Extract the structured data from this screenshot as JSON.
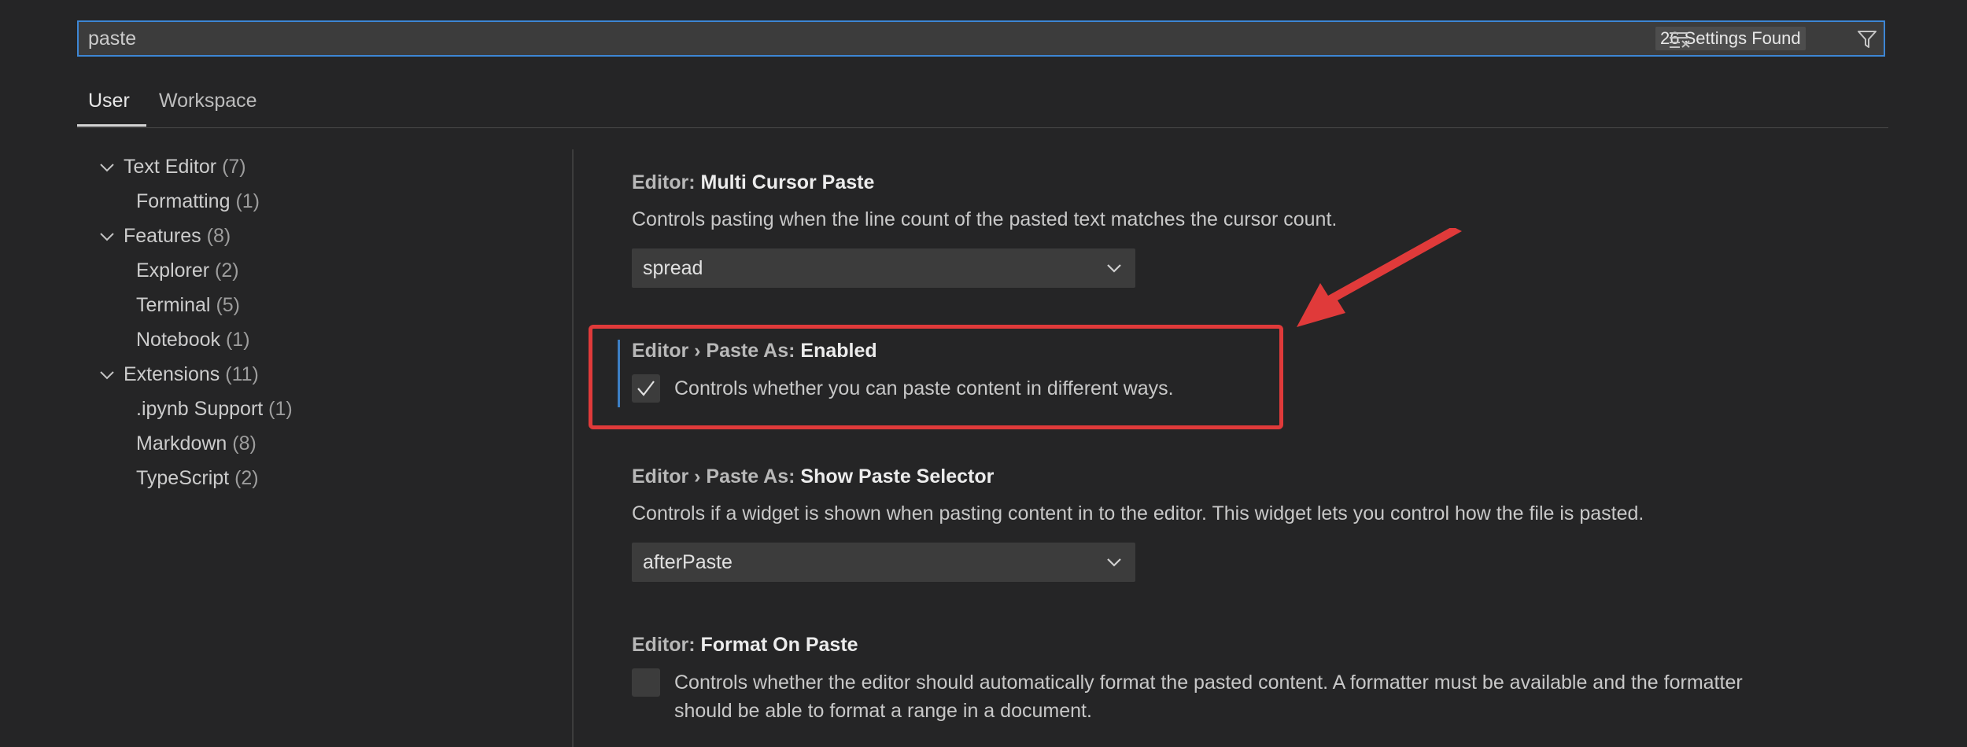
{
  "search": {
    "value": "paste",
    "found_label": "26 Settings Found"
  },
  "tabs": [
    {
      "label": "User",
      "active": true
    },
    {
      "label": "Workspace",
      "active": false
    }
  ],
  "toc": [
    {
      "label": "Text Editor",
      "count": "(7)",
      "expandable": true
    },
    {
      "label": "Formatting",
      "count": "(1)",
      "expandable": false
    },
    {
      "label": "Features",
      "count": "(8)",
      "expandable": true
    },
    {
      "label": "Explorer",
      "count": "(2)",
      "expandable": false
    },
    {
      "label": "Terminal",
      "count": "(5)",
      "expandable": false
    },
    {
      "label": "Notebook",
      "count": "(1)",
      "expandable": false
    },
    {
      "label": "Extensions",
      "count": "(11)",
      "expandable": true
    },
    {
      "label": ".ipynb Support",
      "count": "(1)",
      "expandable": false
    },
    {
      "label": "Markdown",
      "count": "(8)",
      "expandable": false
    },
    {
      "label": "TypeScript",
      "count": "(2)",
      "expandable": false
    }
  ],
  "settings": [
    {
      "category": "Editor: ",
      "name": "Multi Cursor Paste",
      "description": "Controls pasting when the line count of the pasted text matches the cursor count.",
      "control": "dropdown",
      "value": "spread"
    },
    {
      "category": "Editor › Paste As: ",
      "name": "Enabled",
      "description": "Controls whether you can paste content in different ways.",
      "control": "checkbox",
      "checked": true
    },
    {
      "category": "Editor › Paste As: ",
      "name": "Show Paste Selector",
      "description": "Controls if a widget is shown when pasting content in to the editor. This widget lets you control how the file is pasted.",
      "control": "dropdown",
      "value": "afterPaste"
    },
    {
      "category": "Editor: ",
      "name": "Format On Paste",
      "description_line1": "Controls whether the editor should automatically format the pasted content. A formatter must be available and the formatter",
      "description_line2": "should be able to format a range in a document.",
      "control": "checkbox",
      "checked": false
    }
  ],
  "colors": {
    "accent": "#3d86d4",
    "highlight": "#e03a3a",
    "modified": "#3d7fc4",
    "background": "#252526"
  },
  "icons": {
    "clear": "clear-filter-icon",
    "filter": "filter-icon",
    "chevron": "chevron-down-icon",
    "check": "check-icon"
  }
}
